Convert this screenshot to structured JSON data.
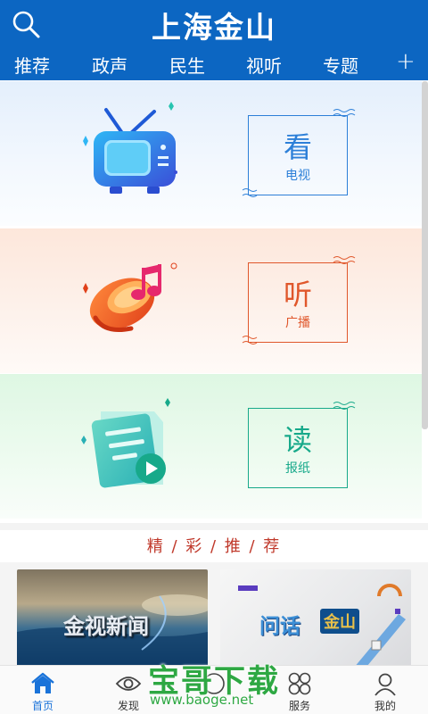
{
  "header": {
    "title": "上海金山",
    "search_icon": "search-icon",
    "background": "#0c66c2"
  },
  "tabs": [
    {
      "label": "推荐",
      "active": false
    },
    {
      "label": "政声",
      "active": false
    },
    {
      "label": "民生",
      "active": false
    },
    {
      "label": "视听",
      "active": true
    },
    {
      "label": "专题",
      "active": false
    }
  ],
  "tab_add_label": "+",
  "sections": [
    {
      "main": "看",
      "sub": "电视",
      "color": "#2c7fd8",
      "icon": "tv-icon"
    },
    {
      "main": "听",
      "sub": "广播",
      "color": "#e0572b",
      "icon": "radio-speaker-icon"
    },
    {
      "main": "读",
      "sub": "报纸",
      "color": "#17a98a",
      "icon": "newspaper-icon"
    }
  ],
  "recommend": {
    "title": "精 / 彩 / 推 / 荐",
    "cards": [
      {
        "text": "金视新闻"
      },
      {
        "text": "问话",
        "badge": "金山"
      }
    ]
  },
  "watermark": {
    "main": "宝哥下载",
    "url": "www.baoge.net"
  },
  "bottom_nav": [
    {
      "label": "首页",
      "icon": "home-icon",
      "active": true
    },
    {
      "label": "发现",
      "icon": "eye-icon",
      "active": false
    },
    {
      "label": "",
      "icon": "center-icon",
      "active": false
    },
    {
      "label": "服务",
      "icon": "service-icon",
      "active": false
    },
    {
      "label": "我的",
      "icon": "user-icon",
      "active": false
    }
  ],
  "accent_color": "#1a73d9"
}
